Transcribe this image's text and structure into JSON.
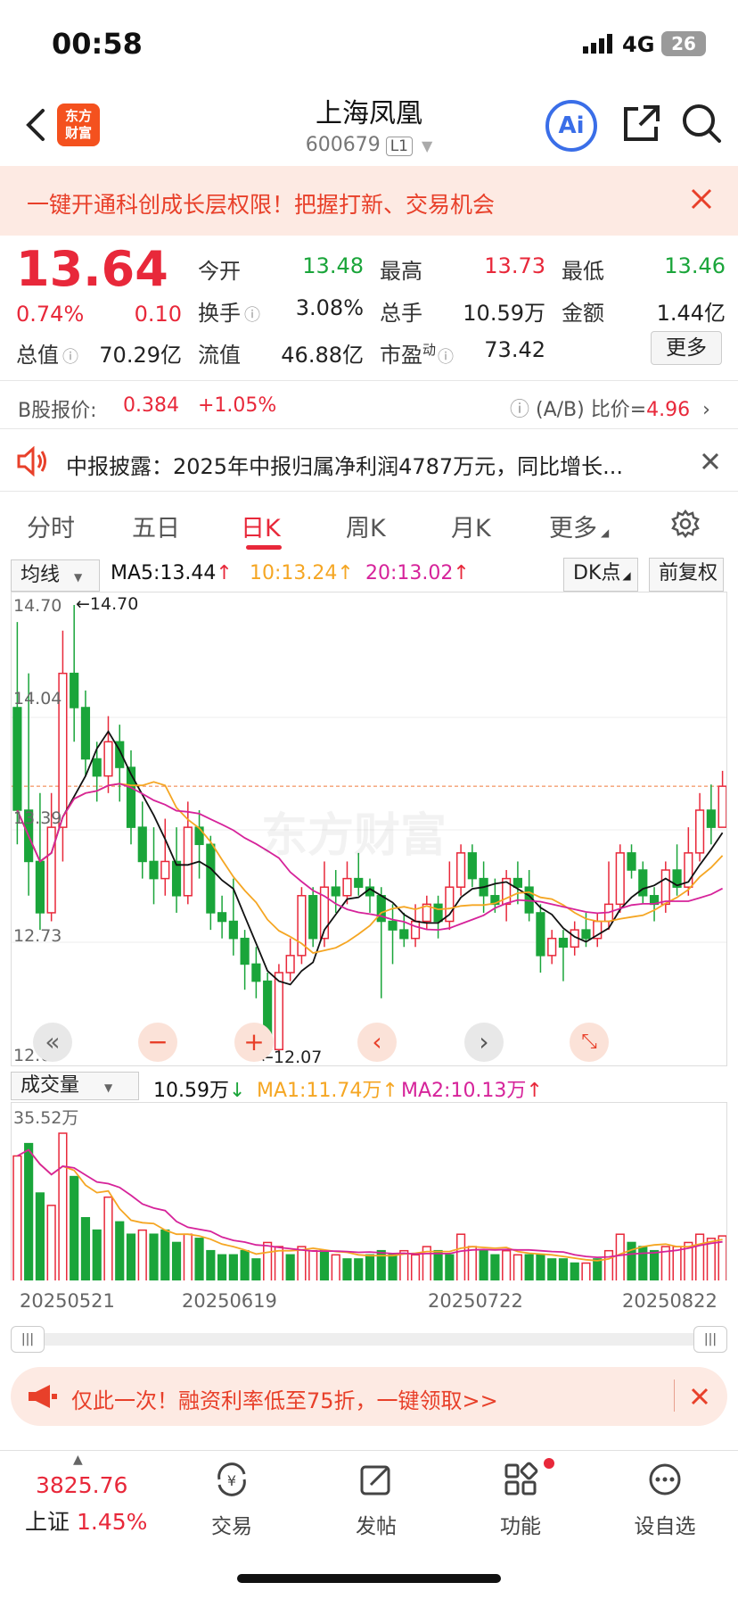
{
  "status_bar": {
    "time": "00:58",
    "network": "4G",
    "battery": "26"
  },
  "header": {
    "back_icon": "chevron-left-icon",
    "logo_text": "东方\n财富",
    "title": "上海凤凰",
    "code": "600679",
    "level": "L1",
    "ai_label": "Ai",
    "share_icon": "share-icon",
    "search_icon": "search-icon"
  },
  "banner": {
    "text": "一键开通科创成长层权限！把握打新、交易机会"
  },
  "quote": {
    "price": "13.64",
    "change_pct": "0.74%",
    "change": "0.10",
    "open_label": "今开",
    "open": "13.48",
    "high_label": "最高",
    "high": "13.73",
    "low_label": "最低",
    "low": "13.46",
    "turnover_label": "换手",
    "turnover": "3.08%",
    "volume_label": "总手",
    "volume": "10.59万",
    "amount_label": "金额",
    "amount": "1.44亿",
    "mktcap_label": "总值",
    "mktcap": "70.29亿",
    "float_label": "流值",
    "float": "46.88亿",
    "pe_label": "市盈",
    "pe_sup": "动",
    "pe": "73.42",
    "more": "更多"
  },
  "bshare": {
    "label": "B股报价:",
    "price": "0.384",
    "pct": "+1.05%",
    "ratio_label": "(A/B) 比价=",
    "ratio": "4.96"
  },
  "notice": {
    "text": "中报披露：2025年中报归属净利润4787万元，同比增长..."
  },
  "tabs": [
    "分时",
    "五日",
    "日K",
    "周K",
    "月K",
    "更多"
  ],
  "ma_bar": {
    "selector": "均线",
    "ma5": "MA5:13.44",
    "ma10": "10:13.24",
    "ma20": "20:13.02",
    "dk": "DK点",
    "adjust": "前复权"
  },
  "kline": {
    "y_labels": [
      "14.70",
      "14.04",
      "13.39",
      "12.73",
      "12.07"
    ],
    "max_label": "14.70",
    "min_label": "12.07",
    "watermark": "东方财富"
  },
  "volume_bar": {
    "selector": "成交量",
    "vol": "10.59万",
    "ma1": "MA1:11.74万",
    "ma2": "MA2:10.13万",
    "max_label": "35.52万"
  },
  "dates": [
    "20250521",
    "20250619",
    "20250722",
    "20250822"
  ],
  "promo": {
    "text": "仅此一次！融资利率低至75折，一键领取>>"
  },
  "bottom_nav": {
    "index_value": "3825.76",
    "index_name": "上证",
    "index_pct": "1.45%",
    "items": [
      "交易",
      "发帖",
      "功能",
      "设自选"
    ]
  },
  "colors": {
    "up": "#e8283a",
    "down": "#1aa53a",
    "ma5": "#111111",
    "ma10": "#f5a623",
    "ma20": "#d6239a",
    "accent": "#3a6ee8"
  },
  "chart_data": {
    "type": "candlestick",
    "ylim": [
      12.07,
      14.7
    ],
    "candles": [
      [
        14.1,
        13.5,
        14.6,
        13.3
      ],
      [
        13.5,
        13.2,
        14.3,
        13.0
      ],
      [
        13.2,
        12.9,
        13.6,
        12.8
      ],
      [
        12.9,
        13.4,
        13.6,
        12.85
      ],
      [
        13.4,
        14.3,
        14.55,
        13.2
      ],
      [
        14.3,
        14.1,
        14.7,
        13.9
      ],
      [
        14.1,
        13.8,
        14.2,
        13.7
      ],
      [
        13.8,
        13.7,
        13.9,
        13.55
      ],
      [
        13.7,
        13.9,
        14.05,
        13.6
      ],
      [
        13.9,
        13.75,
        14.0,
        13.55
      ],
      [
        13.75,
        13.4,
        13.85,
        13.3
      ],
      [
        13.4,
        13.2,
        13.55,
        13.1
      ],
      [
        13.2,
        13.1,
        13.4,
        12.95
      ],
      [
        13.1,
        13.2,
        13.45,
        13.0
      ],
      [
        13.2,
        13.0,
        13.4,
        12.9
      ],
      [
        13.0,
        13.4,
        13.55,
        12.95
      ],
      [
        13.4,
        13.3,
        13.5,
        13.1
      ],
      [
        13.3,
        12.9,
        13.35,
        12.8
      ],
      [
        12.9,
        12.85,
        13.0,
        12.75
      ],
      [
        12.85,
        12.75,
        13.1,
        12.65
      ],
      [
        12.75,
        12.6,
        12.8,
        12.45
      ],
      [
        12.6,
        12.5,
        12.7,
        12.4
      ],
      [
        12.5,
        12.1,
        12.55,
        12.07
      ],
      [
        12.1,
        12.55,
        12.6,
        12.08
      ],
      [
        12.55,
        12.65,
        12.75,
        12.5
      ],
      [
        12.65,
        13.0,
        13.05,
        12.6
      ],
      [
        13.0,
        12.75,
        13.05,
        12.7
      ],
      [
        12.75,
        13.05,
        13.2,
        12.7
      ],
      [
        13.05,
        13.0,
        13.15,
        12.9
      ],
      [
        13.0,
        13.1,
        13.2,
        12.95
      ],
      [
        13.1,
        13.05,
        13.25,
        13.0
      ],
      [
        13.05,
        13.0,
        13.1,
        12.9
      ],
      [
        13.0,
        12.85,
        13.05,
        12.4
      ],
      [
        12.85,
        12.8,
        12.95,
        12.6
      ],
      [
        12.8,
        12.75,
        12.9,
        12.7
      ],
      [
        12.75,
        12.85,
        12.95,
        12.7
      ],
      [
        12.85,
        12.95,
        13.0,
        12.8
      ],
      [
        12.95,
        12.85,
        13.0,
        12.75
      ],
      [
        12.85,
        13.05,
        13.2,
        12.8
      ],
      [
        13.05,
        13.25,
        13.3,
        13.0
      ],
      [
        13.25,
        13.1,
        13.3,
        13.05
      ],
      [
        13.1,
        13.0,
        13.2,
        12.9
      ],
      [
        13.0,
        12.95,
        13.1,
        12.9
      ],
      [
        12.95,
        13.1,
        13.15,
        12.85
      ],
      [
        13.1,
        13.05,
        13.2,
        12.95
      ],
      [
        13.05,
        12.9,
        13.15,
        12.85
      ],
      [
        12.9,
        12.65,
        12.95,
        12.55
      ],
      [
        12.65,
        12.75,
        12.8,
        12.6
      ],
      [
        12.75,
        12.7,
        12.8,
        12.5
      ],
      [
        12.7,
        12.8,
        12.85,
        12.65
      ],
      [
        12.8,
        12.75,
        12.9,
        12.7
      ],
      [
        12.75,
        12.85,
        12.9,
        12.7
      ],
      [
        12.85,
        12.95,
        13.2,
        12.8
      ],
      [
        12.95,
        13.25,
        13.3,
        12.9
      ],
      [
        13.25,
        13.15,
        13.3,
        13.1
      ],
      [
        13.15,
        13.0,
        13.2,
        12.95
      ],
      [
        13.0,
        12.95,
        13.05,
        12.85
      ],
      [
        12.95,
        13.15,
        13.2,
        12.9
      ],
      [
        13.15,
        13.05,
        13.3,
        13.0
      ],
      [
        13.05,
        13.25,
        13.4,
        13.0
      ],
      [
        13.25,
        13.5,
        13.6,
        13.2
      ],
      [
        13.5,
        13.4,
        13.65,
        13.3
      ],
      [
        13.4,
        13.64,
        13.73,
        13.46
      ]
    ],
    "volume": [
      [
        30,
        1
      ],
      [
        33,
        0
      ],
      [
        21,
        0
      ],
      [
        18,
        1
      ],
      [
        35.52,
        1
      ],
      [
        25,
        0
      ],
      [
        15,
        0
      ],
      [
        12,
        0
      ],
      [
        20,
        1
      ],
      [
        14,
        0
      ],
      [
        11,
        0
      ],
      [
        12,
        1
      ],
      [
        11,
        0
      ],
      [
        12,
        0
      ],
      [
        9,
        0
      ],
      [
        11,
        1
      ],
      [
        10,
        0
      ],
      [
        7,
        0
      ],
      [
        6,
        0
      ],
      [
        6,
        0
      ],
      [
        7,
        0
      ],
      [
        5,
        0
      ],
      [
        9,
        1
      ],
      [
        8,
        1
      ],
      [
        6,
        0
      ],
      [
        8,
        1
      ],
      [
        7,
        1
      ],
      [
        7,
        0
      ],
      [
        6,
        1
      ],
      [
        5,
        0
      ],
      [
        5,
        0
      ],
      [
        6,
        0
      ],
      [
        7,
        0
      ],
      [
        6,
        0
      ],
      [
        7,
        1
      ],
      [
        6,
        1
      ],
      [
        8,
        1
      ],
      [
        7,
        0
      ],
      [
        6,
        0
      ],
      [
        11,
        1
      ],
      [
        8,
        1
      ],
      [
        7,
        0
      ],
      [
        6,
        0
      ],
      [
        7,
        1
      ],
      [
        6,
        1
      ],
      [
        6,
        0
      ],
      [
        6,
        0
      ],
      [
        5,
        0
      ],
      [
        5,
        0
      ],
      [
        4,
        0
      ],
      [
        4,
        1
      ],
      [
        5,
        0
      ],
      [
        7,
        1
      ],
      [
        11,
        1
      ],
      [
        9,
        0
      ],
      [
        8,
        0
      ],
      [
        7,
        0
      ],
      [
        8,
        1
      ],
      [
        8,
        1
      ],
      [
        9,
        1
      ],
      [
        11,
        1
      ],
      [
        10,
        1
      ],
      [
        10.59,
        1
      ]
    ],
    "dates": [
      "20250521",
      "20250619",
      "20250722",
      "20250822"
    ]
  }
}
